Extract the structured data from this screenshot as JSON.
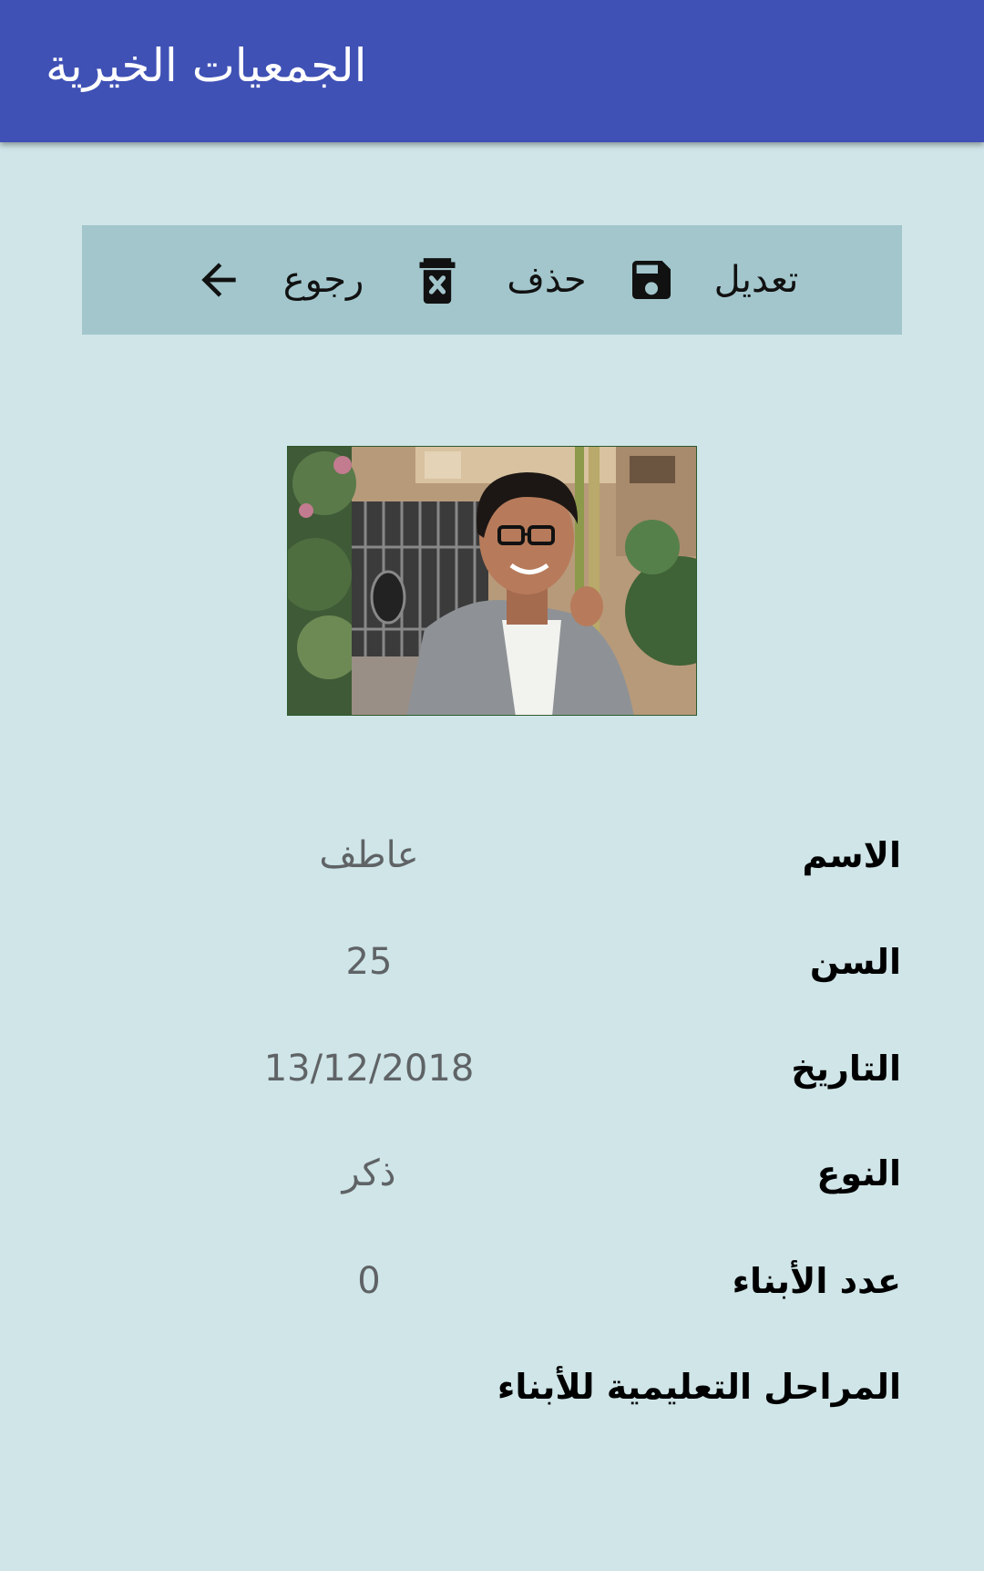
{
  "app_bar": {
    "title": "الجمعيات الخيرية",
    "background": "#3f51b5"
  },
  "toolbar": {
    "edit_label": "تعديل",
    "delete_label": "حذف",
    "back_label": "رجوع",
    "icons": [
      "save-icon",
      "delete-icon",
      "arrow-back-icon"
    ]
  },
  "photo": {
    "alt": "person photo"
  },
  "fields": {
    "name_label": "الاسم",
    "name_value": "عاطف",
    "age_label": "السن",
    "age_value": "25",
    "date_label": "التاريخ",
    "date_value": "13/12/2018",
    "gender_label": "النوع",
    "gender_value": "ذكر",
    "children_label": "عدد الأبناء",
    "children_value": "0",
    "stages_label": "المراحل التعليمية للأبناء"
  },
  "colors": {
    "background": "#cfe5e8",
    "toolbar": "#a2c6cc",
    "value_text": "#5f6366"
  }
}
